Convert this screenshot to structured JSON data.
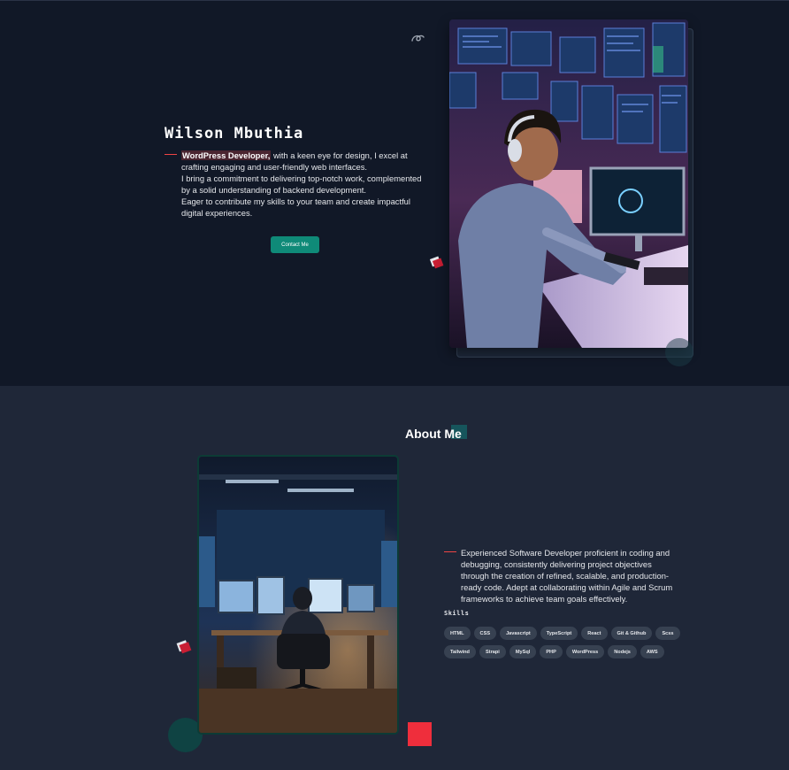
{
  "hero": {
    "name": "Wilson Mbuthia",
    "role": "WordPress Developer,",
    "description_lines": [
      " with a keen eye for design, I excel at crafting engaging and user-friendly web interfaces.",
      "I bring a commitment to delivering top-notch work, complemented by a solid understanding of backend development.",
      "Eager to contribute my skills to your team and create impactful digital experiences."
    ],
    "contact_button": "Contact Me",
    "image_alt": "Developer working at a desk with many monitors"
  },
  "about": {
    "title": "About Me",
    "description": "Experienced Software Developer proficient in coding and debugging, consistently delivering project objectives through the creation of refined, scalable, and production-ready code. Adept at collaborating within Agile and Scrum frameworks to achieve team goals effectively.",
    "skills_label": "Skills",
    "skills": [
      "HTML",
      "CSS",
      "Javascript",
      "TypeScript",
      "React",
      "Git & Github",
      "Scss",
      "Tailwind",
      "Strapi",
      "MySql",
      "PHP",
      "WordPress",
      "Nodejs",
      "AWS"
    ],
    "image_alt": "Developer seated in front of multiple monitors in a dark room"
  },
  "colors": {
    "hero_bg": "#111827",
    "about_bg": "#1f2738",
    "accent_teal": "#0f8a78",
    "accent_red": "#ef2e3c",
    "chip_bg": "#374151"
  },
  "icons": [
    "swirl-icon",
    "cube-icon"
  ]
}
